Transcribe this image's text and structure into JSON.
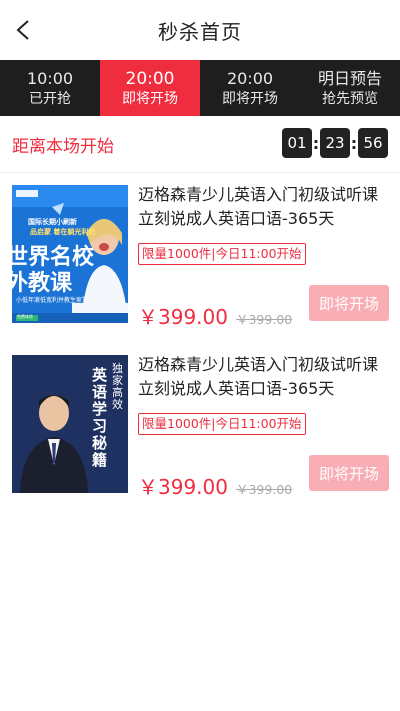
{
  "header": {
    "title": "秒杀首页",
    "back_icon": "chevron-left-icon"
  },
  "tabs": [
    {
      "time": "10:00",
      "status": "已开抢",
      "active": false
    },
    {
      "time": "20:00",
      "status": "即将开场",
      "active": true
    },
    {
      "time": "20:00",
      "status": "即将开场",
      "active": false
    },
    {
      "time": "明日预告",
      "status": "抢先预览",
      "active": false
    }
  ],
  "countdown": {
    "label": "距离本场开始",
    "hours": "01",
    "minutes": "23",
    "seconds": "56"
  },
  "products": [
    {
      "title": "迈格森青少儿英语入门初级试听课立刻说成人英语口语-365天",
      "limit": "限量1000件|今日11:00开始",
      "price": "￥399.00",
      "original_price": "￥399.00",
      "button": "即将开场",
      "thumb": {
        "banner_lines": [
          "国际长期小刷新",
          "品启蒙 着在躺光利奶"
        ],
        "headline_1": "世界名校",
        "headline_2": "外教课",
        "footer": "小低年滚低宽利并教生家置",
        "badge": "免费体验"
      }
    },
    {
      "title": "迈格森青少儿英语入门初级试听课立刻说成人英语口语-365天",
      "limit": "限量1000件|今日11:00开始",
      "price": "￥399.00",
      "original_price": "￥399.00",
      "button": "即将开场",
      "thumb": {
        "side_text": "独家高效",
        "main_text": "英语学习秘籍"
      }
    }
  ],
  "colors": {
    "accent": "#ef2d3f",
    "tab_bg": "#1e1e1e",
    "button_disabled": "#f9aeb5"
  }
}
